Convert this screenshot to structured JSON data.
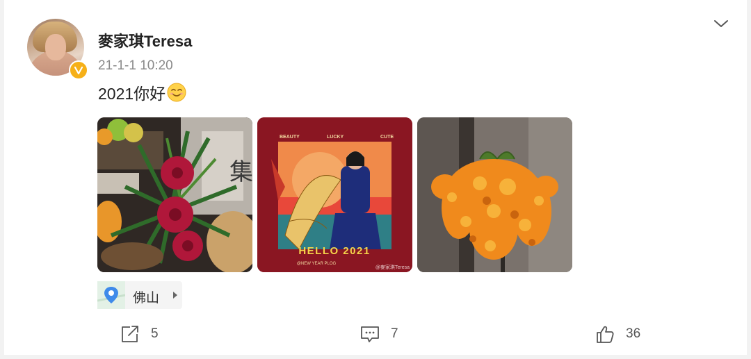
{
  "post": {
    "username": "麥家琪Teresa",
    "timestamp": "21-1-1 10:20",
    "text": "2021你好",
    "emoji_icon": "smile-emoji-icon",
    "verified_badge_color": "#f6b018",
    "images": [
      {
        "name": "flower-arrangement-photo"
      },
      {
        "name": "hello-2021-poster",
        "top_labels": [
          "BEAUTY",
          "LUCKY",
          "CUTE"
        ],
        "headline": "HELLO 2021",
        "subline": "@NEW YEAR PLOG",
        "watermark": "@麥家琪Teresa"
      },
      {
        "name": "orange-blossom-photo"
      }
    ],
    "location": {
      "label": "佛山",
      "icon": "location-pin-icon"
    }
  },
  "actions": {
    "repost_count": "5",
    "comment_count": "7",
    "like_count": "36"
  }
}
